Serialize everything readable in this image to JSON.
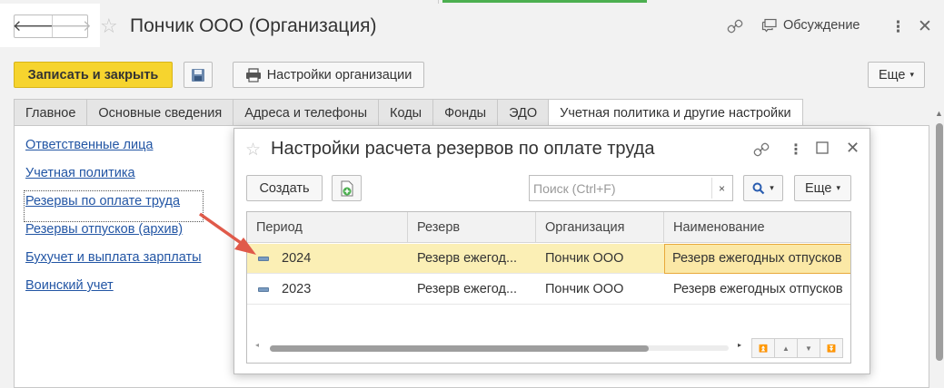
{
  "window": {
    "title": "Пончик ООО (Организация)",
    "discussion_label": "Обсуждение"
  },
  "toolbar": {
    "save_close_label": "Записать и закрыть",
    "org_settings_label": "Настройки организации",
    "more_label": "Еще"
  },
  "tabs": [
    {
      "label": "Главное"
    },
    {
      "label": "Основные сведения"
    },
    {
      "label": "Адреса и телефоны"
    },
    {
      "label": "Коды"
    },
    {
      "label": "Фонды"
    },
    {
      "label": "ЭДО"
    },
    {
      "label": "Учетная политика и другие настройки",
      "active": true
    }
  ],
  "links": [
    {
      "label": "Ответственные лица"
    },
    {
      "label": "Учетная политика"
    },
    {
      "label": "Резервы по оплате труда",
      "selected": true
    },
    {
      "label": "Резервы отпусков (архив)"
    },
    {
      "label": "Бухучет и выплата зарплаты"
    },
    {
      "label": "Воинский учет"
    }
  ],
  "dialog": {
    "title": "Настройки расчета резервов по оплате труда",
    "create_label": "Создать",
    "search_placeholder": "Поиск (Ctrl+F)",
    "clear_label": "×",
    "more_label": "Еще",
    "columns": [
      "Период",
      "Резерв",
      "Организация",
      "Наименование"
    ],
    "rows": [
      {
        "period": "2024",
        "reserve": "Резерв ежегод...",
        "org": "Пончик ООО",
        "name": "Резерв ежегодных отпусков",
        "selected": true
      },
      {
        "period": "2023",
        "reserve": "Резерв ежегод...",
        "org": "Пончик ООО",
        "name": "Резерв ежегодных отпусков",
        "selected": false
      }
    ]
  },
  "colors": {
    "primary_button": "#f6d42e",
    "selected_row": "#fbefb5",
    "link": "#2255a4",
    "annotation_arrow": "#e05a4a"
  }
}
